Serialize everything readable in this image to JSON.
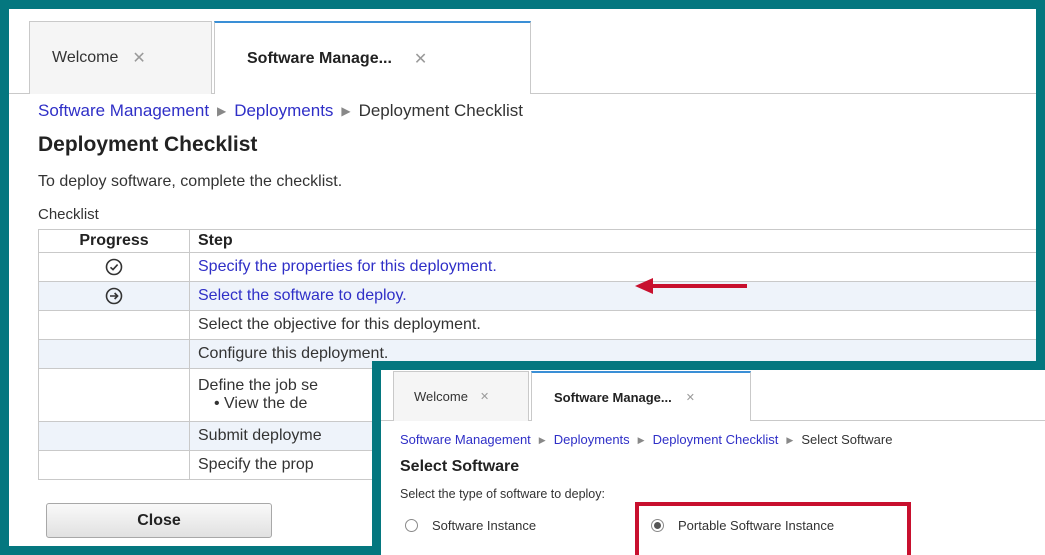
{
  "main": {
    "tabs": [
      {
        "label": "Welcome",
        "close": "✕"
      },
      {
        "label": "Software Manage...",
        "close": "✕"
      }
    ],
    "breadcrumb": [
      "Software Management",
      "Deployments",
      "Deployment Checklist"
    ],
    "breadcrumb_sep": "▶",
    "title": "Deployment Checklist",
    "description": "To deploy software, complete the checklist.",
    "checklist_label": "Checklist",
    "table": {
      "headers": [
        "Progress",
        "Step"
      ],
      "rows": [
        {
          "progress_icon": "check-circle-icon",
          "step": "Specify the properties for this deployment."
        },
        {
          "progress_icon": "arrow-circle-icon",
          "step": "Select the software to deploy."
        },
        {
          "step": "Select the objective for this deployment."
        },
        {
          "step": "Configure this deployment."
        },
        {
          "step": "Define the job se",
          "bullet": "View the de"
        },
        {
          "step": "Submit deployme"
        },
        {
          "step": "Specify the prop"
        }
      ]
    },
    "close_button": "Close"
  },
  "inset": {
    "tabs": [
      {
        "label": "Welcome",
        "close": "✕"
      },
      {
        "label": "Software Manage...",
        "close": "✕"
      }
    ],
    "breadcrumb": [
      "Software Management",
      "Deployments",
      "Deployment Checklist",
      "Select Software"
    ],
    "title": "Select Software",
    "prompt": "Select the type of software to deploy:",
    "options": [
      {
        "label": "Software Instance",
        "selected": false
      },
      {
        "label": "Portable Software Instance",
        "selected": true
      }
    ]
  },
  "colors": {
    "frame": "#04777f",
    "link": "#2f2fc7",
    "highlight": "#c8102e"
  }
}
